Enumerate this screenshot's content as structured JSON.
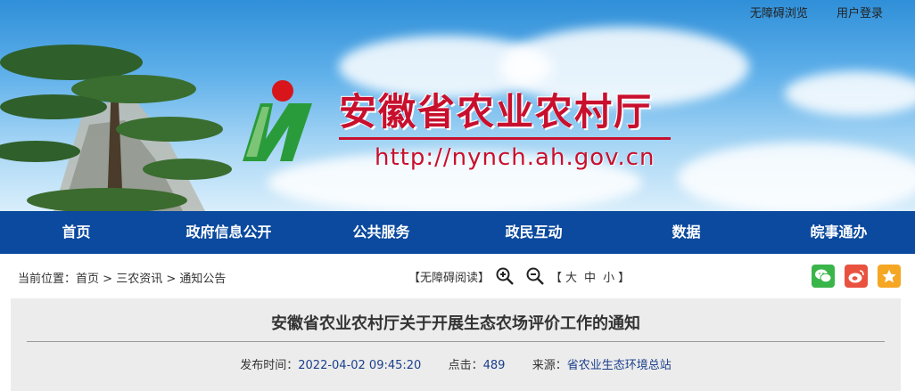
{
  "header": {
    "top_links": [
      "无障碍浏览",
      "用户登录"
    ],
    "site_title": "安徽省农业农村厅",
    "site_url": "http://nynch.ah.gov.cn"
  },
  "nav": {
    "items": [
      "首页",
      "政府信息公开",
      "公共服务",
      "政民互动",
      "数据",
      "皖事通办"
    ]
  },
  "breadcrumb": {
    "prefix": "当前位置：",
    "items": [
      "首页",
      "三农资讯",
      "通知公告"
    ],
    "separator": ">"
  },
  "tools": {
    "accessibility": "【无障碍阅读】",
    "bracket_open": "【",
    "bracket_close": "】",
    "sizes": [
      "大",
      "中",
      "小"
    ]
  },
  "share": {
    "icons": [
      "wechat-icon",
      "weibo-icon",
      "favorite-icon"
    ],
    "colors": [
      "#3ab54a",
      "#e8523f",
      "#f5a623"
    ]
  },
  "article": {
    "title": "安徽省农业农村厅关于开展生态农场评价工作的通知",
    "publish_label": "发布时间：",
    "publish_time": "2022-04-02 09:45:20",
    "views_label": "点击：",
    "views": "489",
    "source_label": "来源：",
    "source": "省农业生态环境总站"
  },
  "colors": {
    "nav_bg": "#0b4a9e",
    "title_red": "#c8102e",
    "meta_blue": "#1b3f8c"
  }
}
